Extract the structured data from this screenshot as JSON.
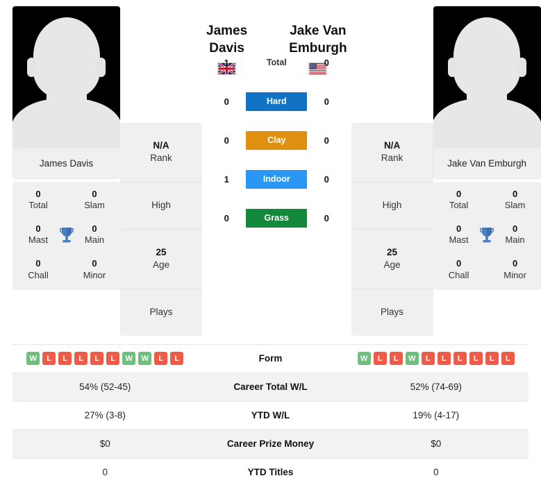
{
  "players": {
    "left": {
      "name": "James Davis",
      "photo_caption": "James Davis",
      "flag": "united-kingdom-flag",
      "rank_value": "N/A",
      "rank_label": "Rank",
      "high_label": "High",
      "age_value": "25",
      "age_label": "Age",
      "plays_label": "Plays",
      "titles": [
        {
          "value": "0",
          "label": "Total"
        },
        {
          "value": "0",
          "label": "Slam"
        },
        {
          "value": "0",
          "label": "Mast"
        },
        {
          "value": "0",
          "label": "Main"
        },
        {
          "value": "0",
          "label": "Chall"
        },
        {
          "value": "0",
          "label": "Minor"
        }
      ],
      "form": [
        "W",
        "L",
        "L",
        "L",
        "L",
        "L",
        "W",
        "W",
        "L",
        "L"
      ]
    },
    "right": {
      "name": "Jake Van Emburgh",
      "photo_caption": "Jake Van Emburgh",
      "flag": "united-states-flag",
      "rank_value": "N/A",
      "rank_label": "Rank",
      "high_label": "High",
      "age_value": "25",
      "age_label": "Age",
      "plays_label": "Plays",
      "titles": [
        {
          "value": "0",
          "label": "Total"
        },
        {
          "value": "0",
          "label": "Slam"
        },
        {
          "value": "0",
          "label": "Mast"
        },
        {
          "value": "0",
          "label": "Main"
        },
        {
          "value": "0",
          "label": "Chall"
        },
        {
          "value": "0",
          "label": "Minor"
        }
      ],
      "form": [
        "W",
        "L",
        "L",
        "W",
        "L",
        "L",
        "L",
        "L",
        "L",
        "L"
      ]
    }
  },
  "head_to_head": [
    {
      "label": "Total",
      "left": "1",
      "right": "0",
      "color": "none",
      "style": "plain"
    },
    {
      "label": "Hard",
      "left": "0",
      "right": "0",
      "color": "#1273C4",
      "style": "badge"
    },
    {
      "label": "Clay",
      "left": "0",
      "right": "0",
      "color": "#E09010",
      "style": "badge"
    },
    {
      "label": "Indoor",
      "left": "1",
      "right": "0",
      "color": "#2B97F5",
      "style": "badge"
    },
    {
      "label": "Grass",
      "left": "0",
      "right": "0",
      "color": "#11883A",
      "style": "badge"
    }
  ],
  "stats_table": [
    {
      "label": "Form",
      "left": "",
      "right": "",
      "type": "form",
      "shade": false
    },
    {
      "label": "Career Total W/L",
      "left": "54% (52-45)",
      "right": "52% (74-69)",
      "type": "text",
      "shade": true
    },
    {
      "label": "YTD W/L",
      "left": "27% (3-8)",
      "right": "19% (4-17)",
      "type": "text",
      "shade": false
    },
    {
      "label": "Career Prize Money",
      "left": "$0",
      "right": "$0",
      "type": "text",
      "shade": true
    },
    {
      "label": "YTD Titles",
      "left": "0",
      "right": "0",
      "type": "text",
      "shade": false
    }
  ],
  "colors": {
    "win": "#6FC07F",
    "loss": "#EF5B47",
    "hard": "#1273C4",
    "clay": "#E09010",
    "indoor": "#2B97F5",
    "grass": "#11883A",
    "card_bg": "#f0f0f0",
    "row_shade": "#f2f2f2"
  }
}
